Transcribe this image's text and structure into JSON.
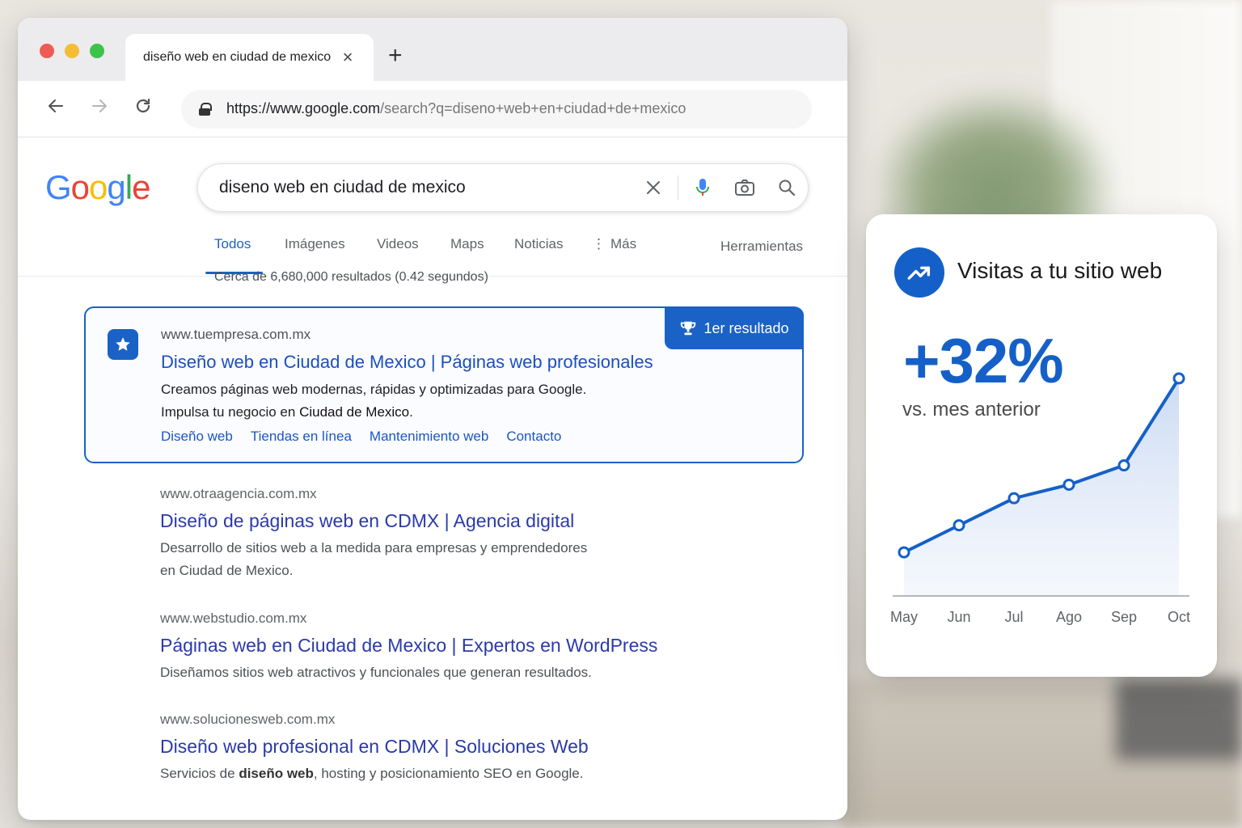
{
  "browser": {
    "tab_title": "diseño web en ciudad de mexico",
    "new_tab": "+",
    "url_host": "https://www.google.com",
    "url_path": "/search?q=diseno+web+en+ciudad+de+mexico"
  },
  "google": {
    "logo": [
      "G",
      "o",
      "o",
      "g",
      "l",
      "e"
    ],
    "query": "diseno web en ciudad de mexico",
    "tabs": [
      "Todos",
      "Imágenes",
      "Videos",
      "Maps",
      "Noticias",
      "Más"
    ],
    "tools": "Herramientas",
    "stats": "Cerca de 6,680,000 resultados (0.42 segundos)"
  },
  "featured": {
    "badge": "1er resultado",
    "url": "www.tuempresa.com.mx",
    "title": "Diseño web en Ciudad de Mexico | Páginas web profesionales",
    "desc_line1": "Creamos páginas web modernas, rápidas y optimizadas para Google.",
    "desc_line2_a": "Impulsa tu negocio en ",
    "desc_line2_b": "Ciudad de Mexico",
    "desc_line2_c": ".",
    "sitelinks": [
      "Diseño web",
      "Tiendas en línea",
      "Mantenimiento web",
      "Contacto"
    ]
  },
  "results": [
    {
      "url": "www.otraagencia.com.mx",
      "title": "Diseño de páginas web en CDMX | Agencia digital",
      "desc1": "Desarrollo de sitios web a la medida para empresas y emprendedores",
      "desc2": "en Ciudad de Mexico."
    },
    {
      "url": "www.webstudio.com.mx",
      "title": "Páginas web en Ciudad de Mexico | Expertos en WordPress",
      "desc1": "Diseñamos sitios web atractivos y funcionales que generan resultados."
    },
    {
      "url": "www.solucionesweb.com.mx",
      "title": "Diseño web profesional en CDMX | Soluciones Web",
      "desc_a": "Servicios de ",
      "desc_b": "diseño web",
      "desc_c": ", hosting y posicionamiento SEO en Google."
    }
  ],
  "card": {
    "title": "Visitas a tu sitio web",
    "value": "+32%",
    "subtitle": "vs. mes anterior"
  },
  "colors": {
    "accent": "#1560c8",
    "link": "#1a4fc2"
  },
  "chart_data": {
    "type": "area",
    "categories": [
      "May",
      "Jun",
      "Jul",
      "Ago",
      "Sep",
      "Oct"
    ],
    "values": [
      10,
      24,
      38,
      45,
      55,
      100
    ],
    "title": "",
    "xlabel": "",
    "ylabel": "",
    "grid": false
  }
}
